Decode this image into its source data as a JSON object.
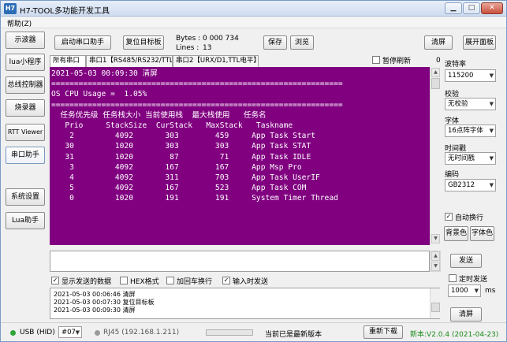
{
  "window": {
    "title": "H7-TOOL多功能开发工具",
    "icon_label": "H7"
  },
  "menu": {
    "help": "帮助(Z)"
  },
  "sidebar": {
    "items": [
      {
        "label": "示波器"
      },
      {
        "label": "lua小程序"
      },
      {
        "label": "总线控制器"
      },
      {
        "label": "烧录器"
      },
      {
        "label": "RTT Viewer"
      },
      {
        "label": "串口助手"
      },
      {
        "label": "系统设置"
      },
      {
        "label": "Lua助手"
      }
    ]
  },
  "toolbar": {
    "start_serial": "启动串口助手",
    "reset_board": "复位目标板",
    "bytes_label": "Bytes :",
    "bytes_value": "0 000 734",
    "lines_label": "Lines :",
    "lines_value": "13",
    "save": "保存",
    "browse": "浏览",
    "clear": "清屏",
    "expand": "展开面板"
  },
  "tabs": [
    {
      "label": "所有串口"
    },
    {
      "label": "串口1【RS485/RS232/TTL】"
    },
    {
      "label": "串口2【URX/D1,TTL电平】"
    }
  ],
  "pause_refresh": "暂停刷新",
  "counter": "0",
  "terminal": {
    "lines": [
      "2021-05-03 00:09:30 清屏",
      "================================================================",
      "OS CPU Usage =  1.05%",
      "================================================================",
      "  任务优先级 任务栈大小 当前使用栈  最大栈使用   任务名",
      "   Prio     StackSize  CurStack   MaxStack   Taskname",
      "    2         4092       303        459     App Task Start",
      "   30         1020       303        303     App Task STAT",
      "   31         1020        87         71     App Task IDLE",
      "    3         4092       167        167     App Msp Pro",
      "    4         4092       311        703     App Task UserIF",
      "    5         4092       167        523     App Task COM",
      "    0         1020       191        191     System Timer Thread"
    ]
  },
  "settings": {
    "baud_label": "波特率",
    "baud_value": "115200",
    "parity_label": "校验",
    "parity_value": "无校验",
    "font_label": "字体",
    "font_value": "16点阵字体",
    "timestamp_label": "时间戳",
    "timestamp_value": "无时间戳",
    "encoding_label": "编码",
    "encoding_value": "GB2312",
    "auto_wrap": "自动换行",
    "bg_color": "背景色",
    "font_color": "字体色"
  },
  "send": {
    "send_button": "发送",
    "timed_send": "定时发送",
    "interval_value": "1000",
    "interval_unit": "ms",
    "clear_button": "清屏",
    "show_sent": "显示发送的数据",
    "hex_format": "HEX格式",
    "add_cr": "加回车换行",
    "send_on_input": "输入时发送"
  },
  "log": {
    "lines": [
      "2021-05-03 00:06:46 清屏",
      "2021-05-03 00:07:30 复位目标板",
      "2021-05-03 00:09:30 清屏"
    ]
  },
  "status": {
    "usb": "USB (HID)",
    "device_no": "#07",
    "rj45": "RJ45 (192.168.1.211)",
    "latest": "当前已是最新版本",
    "redownload": "重新下载",
    "version": "新本:V2.0.4 (2021-04-23)"
  },
  "colors": {
    "terminal_bg": "#800080",
    "usb_dot": "#2fa53a",
    "rj45_dot": "#9a9a9a",
    "version_text": "#1a8a1a"
  }
}
